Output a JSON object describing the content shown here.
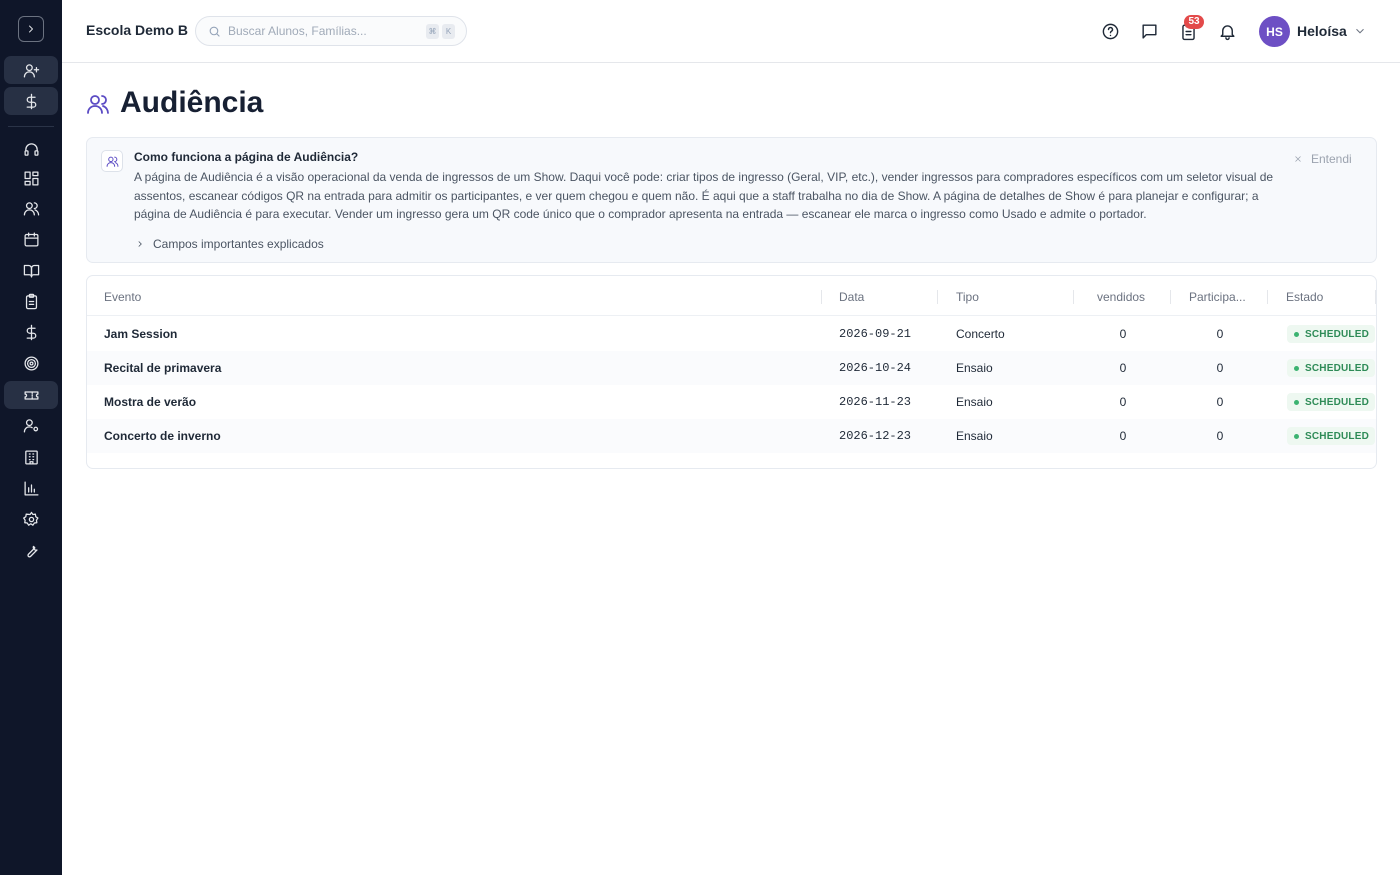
{
  "app": {
    "school_name": "Escola Demo B",
    "search_placeholder": "Buscar Alunos, Famílias...",
    "kbd_keys": [
      "⌘",
      "K"
    ],
    "task_count": "53",
    "user_initials": "HS",
    "user_name": "Heloísa"
  },
  "sidebar": {
    "items": [
      {
        "icon": "user-plus-icon",
        "active": true
      },
      {
        "icon": "dollar-icon",
        "active": true
      },
      {
        "icon": "headset-icon",
        "active": false
      },
      {
        "icon": "dashboard-grid-icon",
        "active": false
      },
      {
        "icon": "users-icon",
        "active": false
      },
      {
        "icon": "calendar-icon",
        "active": false
      },
      {
        "icon": "book-open-icon",
        "active": false
      },
      {
        "icon": "clipboard-icon",
        "active": false
      },
      {
        "icon": "dollar-icon",
        "active": false
      },
      {
        "icon": "target-icon",
        "active": false
      },
      {
        "icon": "ticket-icon",
        "active": true
      },
      {
        "icon": "user-cog-icon",
        "active": false
      },
      {
        "icon": "building-icon",
        "active": false
      },
      {
        "icon": "bar-chart-icon",
        "active": false
      },
      {
        "icon": "settings-gear-icon",
        "active": false
      },
      {
        "icon": "wrench-icon",
        "active": false
      }
    ]
  },
  "page": {
    "title": "Audiência"
  },
  "info": {
    "title": "Como funciona a página de Audiência?",
    "body": "A página de Audiência é a visão operacional da venda de ingressos de um Show. Daqui você pode: criar tipos de ingresso (Geral, VIP, etc.), vender ingressos para compradores específicos com um seletor visual de assentos, escanear códigos QR na entrada para admitir os participantes, e ver quem chegou e quem não. É aqui que a staff trabalha no dia de Show. A página de detalhes de Show é para planejar e configurar; a página de Audiência é para executar. Vender um ingresso gera um QR code único que o comprador apresenta na entrada — escanear ele marca o ingresso como Usado e admite o portador.",
    "expand_label": "Campos importantes explicados",
    "dismiss_label": "Entendi"
  },
  "table": {
    "columns": [
      "Evento",
      "Data",
      "Tipo",
      "vendidos",
      "Participa...",
      "Estado"
    ],
    "rows": [
      {
        "event": "Jam Session",
        "date": "2026-09-21",
        "type": "Concerto",
        "sold": "0",
        "attendees": "0",
        "status": "SCHEDULED"
      },
      {
        "event": "Recital de primavera",
        "date": "2026-10-24",
        "type": "Ensaio",
        "sold": "0",
        "attendees": "0",
        "status": "SCHEDULED"
      },
      {
        "event": "Mostra de verão",
        "date": "2026-11-23",
        "type": "Ensaio",
        "sold": "0",
        "attendees": "0",
        "status": "SCHEDULED"
      },
      {
        "event": "Concerto de inverno",
        "date": "2026-12-23",
        "type": "Ensaio",
        "sold": "0",
        "attendees": "0",
        "status": "SCHEDULED"
      }
    ]
  },
  "colors": {
    "sidebar_bg": "#0f1629",
    "accent": "#5b4bc4",
    "avatar_bg": "#6d4fc4",
    "badge_bg": "#e34a4a",
    "status_green": "#2e8b57"
  }
}
